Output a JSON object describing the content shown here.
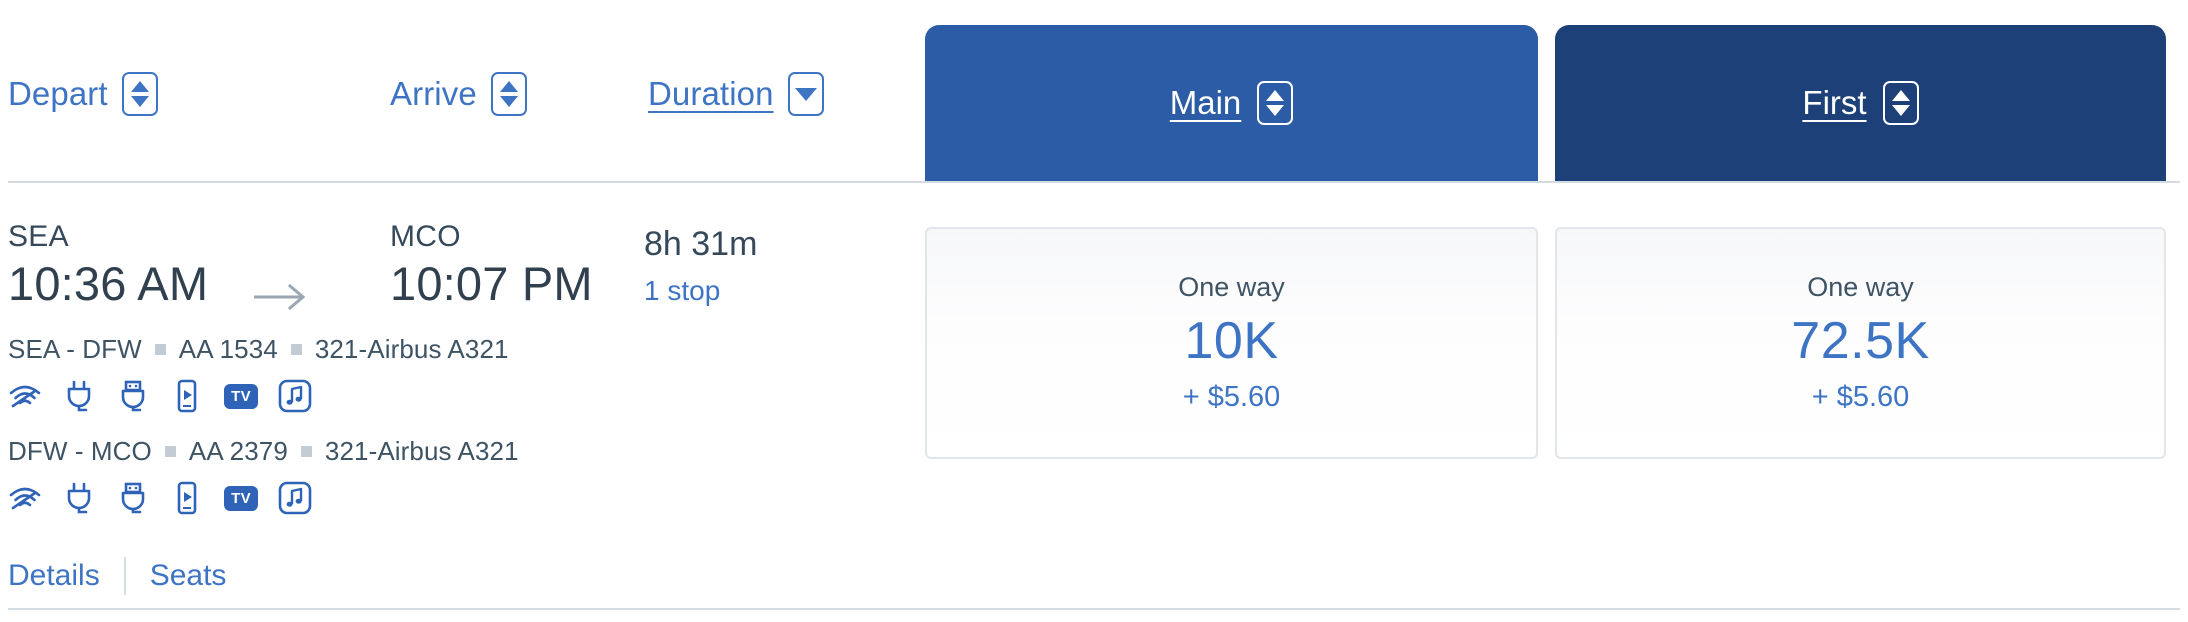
{
  "sort_bar": {
    "controls": [
      {
        "label": "Depart",
        "icon": "sort-updown-icon",
        "state": "inactive",
        "direction": "both"
      },
      {
        "label": "Arrive",
        "icon": "sort-updown-icon",
        "state": "inactive",
        "direction": "both"
      },
      {
        "label": "Duration",
        "icon": "sort-down-icon",
        "state": "active",
        "direction": "down"
      }
    ]
  },
  "cabin_tabs": [
    {
      "label": "Main",
      "icon": "sort-updown-icon",
      "color": "#2B5CA5",
      "selected": false
    },
    {
      "label": "First",
      "icon": "sort-updown-icon",
      "color": "#1C4077",
      "selected": true
    }
  ],
  "flight": {
    "origin": {
      "code": "SEA",
      "time": "10:36 AM"
    },
    "destination": {
      "code": "MCO",
      "time": "10:07 PM"
    },
    "arrow_icon": "arrow-right-icon",
    "duration": "8h 31m",
    "stops": "1 stop",
    "segments": [
      {
        "route": "SEA - DFW",
        "flight_number": "AA 1534",
        "aircraft": "321-Airbus A321",
        "amenities": [
          "wifi-icon",
          "power-outlet-icon",
          "usb-port-icon",
          "streaming-device-icon",
          "tv-icon",
          "music-icon"
        ]
      },
      {
        "route": "DFW - MCO",
        "flight_number": "AA 2379",
        "aircraft": "321-Airbus A321",
        "amenities": [
          "wifi-icon",
          "power-outlet-icon",
          "usb-port-icon",
          "streaming-device-icon",
          "tv-icon",
          "music-icon"
        ]
      }
    ],
    "tv_badge_text": "TV"
  },
  "footer": {
    "details_label": "Details",
    "seats_label": "Seats"
  },
  "fares": [
    {
      "cabin": "Main",
      "kind": "One way",
      "miles": "10K",
      "tax": "+ $5.60"
    },
    {
      "cabin": "First",
      "kind": "One way",
      "miles": "72.5K",
      "tax": "+ $5.60"
    }
  ],
  "colors": {
    "link_blue": "#3E74C4",
    "tab_main": "#2B5CA5",
    "tab_first": "#1C4077",
    "text_dark": "#36495B",
    "divider": "#D3DBE3"
  }
}
